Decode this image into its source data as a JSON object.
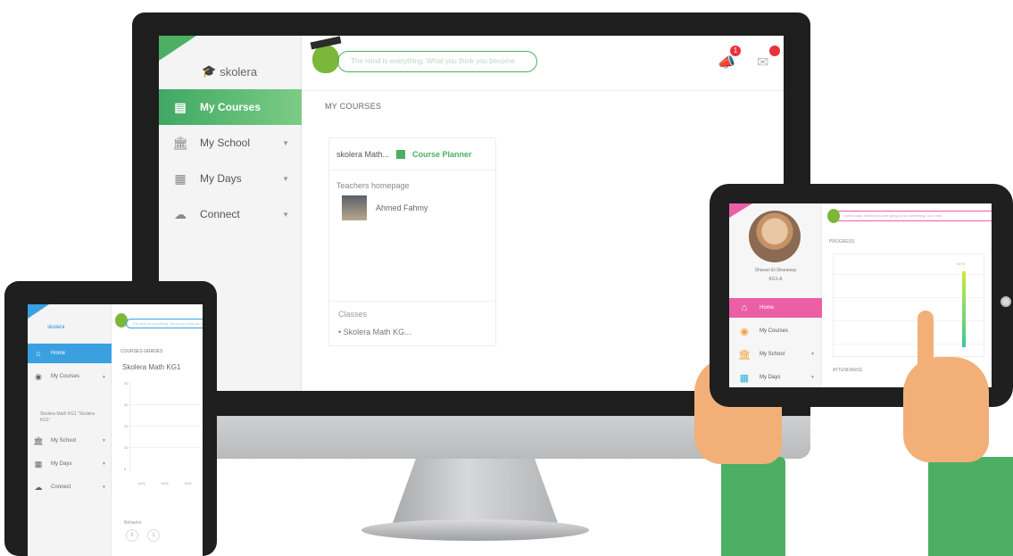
{
  "desktop": {
    "logo_text": "skolera",
    "quote": "The mind is everything. What you think you become",
    "notifications_count": "1",
    "nav": [
      {
        "label": "My Courses",
        "active": true
      },
      {
        "label": "My School",
        "active": false
      },
      {
        "label": "My Days",
        "active": false
      },
      {
        "label": "Connect",
        "active": false
      }
    ],
    "heading": "MY COURSES",
    "course_card": {
      "title": "skolera Math...",
      "planner_label": "Course Planner",
      "teacher_heading": "Teachers homepage",
      "teacher_name": "Ahmed Fahmy",
      "classes_heading": "Classes",
      "class_item": "• Skolera Math KG..."
    }
  },
  "tablet_left": {
    "logo_text": "skolera",
    "quote": "The mind is everything. What you think you become",
    "nav": [
      {
        "label": "Home",
        "active": true
      },
      {
        "label": "My Courses",
        "active": false
      },
      {
        "label": "My School",
        "active": false
      },
      {
        "label": "My Days",
        "active": false
      },
      {
        "label": "Connect",
        "active": false
      }
    ],
    "sub_item": "Skolera Math KG1 \"Skolera KG1\"",
    "heading": "COURSES GRADES",
    "course_title": "Skolera Math KG1",
    "yticks": [
      "40",
      "30",
      "20",
      "10",
      "0"
    ],
    "xlabels": [
      "KG1",
      "KG1",
      "KG1"
    ],
    "footer": "Behavior"
  },
  "tablet_right": {
    "quote": "Learn today. Believe you are going to do something. Do it now",
    "student_name": "Shavan El-Sharaway",
    "student_class": "KG1-A",
    "nav": [
      {
        "label": "Home",
        "active": true
      },
      {
        "label": "My Courses",
        "active": false
      },
      {
        "label": "My School",
        "active": false
      },
      {
        "label": "My Days",
        "active": false
      }
    ],
    "heading": "PROGRESS",
    "bar_label": "90 %",
    "bar_value_percent": 90,
    "attendance_heading": "ATTENDANCE"
  },
  "icons": {
    "nav_courses": "book-icon",
    "nav_school": "building-icon",
    "nav_days": "calendar-icon",
    "nav_connect": "chat-icon",
    "notifications": "megaphone-icon",
    "messages": "envelope-icon"
  },
  "colors": {
    "desktop_accent": "#4caf64",
    "tablet_left_accent": "#3aa0e0",
    "tablet_right_accent": "#ea5fa5"
  }
}
